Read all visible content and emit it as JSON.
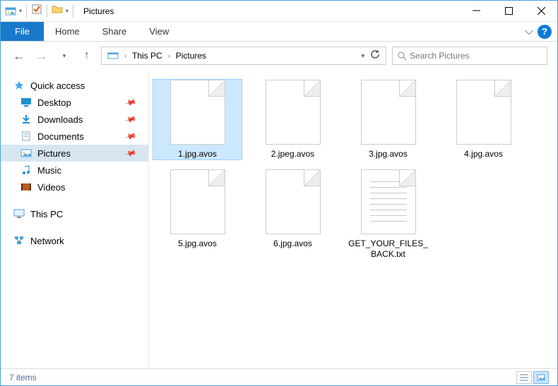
{
  "window": {
    "title": "Pictures",
    "min_label": "Minimize",
    "max_label": "Maximize",
    "close_label": "Close"
  },
  "ribbon": {
    "file_label": "File",
    "tabs": [
      "Home",
      "Share",
      "View"
    ]
  },
  "nav": {
    "back": "Back",
    "forward": "Forward",
    "recent": "Recent locations",
    "up": "Up"
  },
  "address": {
    "root": "This PC",
    "current": "Pictures"
  },
  "search": {
    "placeholder": "Search Pictures"
  },
  "sidebar": {
    "quick_access": "Quick access",
    "items": [
      {
        "label": "Desktop",
        "pinned": true,
        "icon": "desktop"
      },
      {
        "label": "Downloads",
        "pinned": true,
        "icon": "downloads"
      },
      {
        "label": "Documents",
        "pinned": true,
        "icon": "documents"
      },
      {
        "label": "Pictures",
        "pinned": true,
        "icon": "pictures",
        "selected": true
      },
      {
        "label": "Music",
        "pinned": false,
        "icon": "music"
      },
      {
        "label": "Videos",
        "pinned": false,
        "icon": "videos"
      }
    ],
    "this_pc": "This PC",
    "network": "Network"
  },
  "files": [
    {
      "name": "1.jpg.avos",
      "type": "generic",
      "selected": true
    },
    {
      "name": "2.jpeg.avos",
      "type": "generic"
    },
    {
      "name": "3.jpg.avos",
      "type": "generic"
    },
    {
      "name": "4.jpg.avos",
      "type": "generic"
    },
    {
      "name": "5.jpg.avos",
      "type": "generic"
    },
    {
      "name": "6.jpg.avos",
      "type": "generic"
    },
    {
      "name": "GET_YOUR_FILES_BACK.txt",
      "type": "txt"
    }
  ],
  "status": {
    "count_text": "7 items"
  }
}
